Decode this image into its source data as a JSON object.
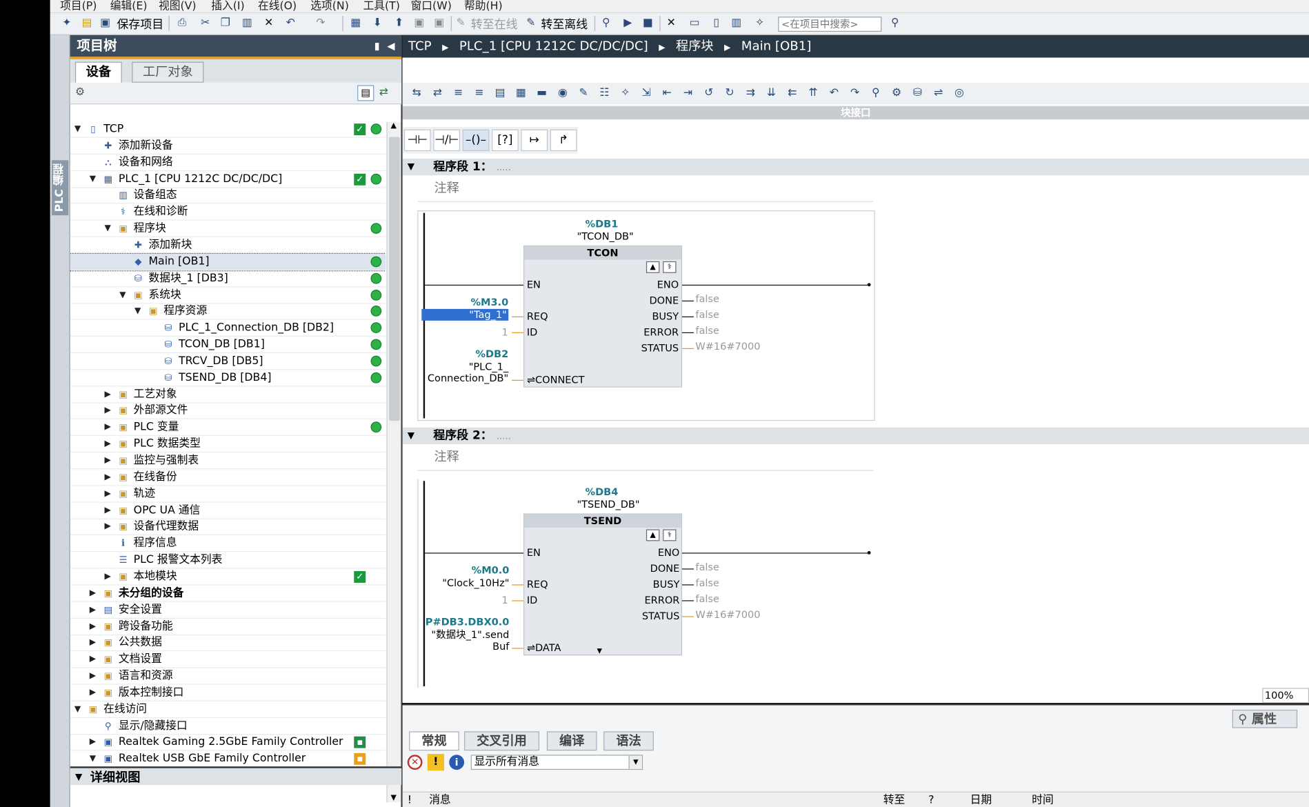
{
  "menu": [
    "项目(P)",
    "编辑(E)",
    "视图(V)",
    "插入(I)",
    "在线(O)",
    "选项(N)",
    "工具(T)",
    "窗口(W)",
    "帮助(H)"
  ],
  "toolbar": {
    "save_label": "保存项目",
    "go_online": "转至在线",
    "go_offline": "转至离线",
    "search_placeholder": "<在项目中搜索>"
  },
  "sidetab_label": "PLC 编程",
  "tree": {
    "title": "项目树",
    "tabs": [
      "设备",
      "工厂对象"
    ],
    "rows": [
      {
        "label": "TCP",
        "arrow": "▼",
        "level": 0,
        "check": true,
        "dot": true,
        "icon": "project-icon"
      },
      {
        "label": "添加新设备",
        "arrow": "",
        "level": 1,
        "icon": "add-device-icon"
      },
      {
        "label": "设备和网络",
        "arrow": "",
        "level": 1,
        "icon": "network-icon"
      },
      {
        "label": "PLC_1 [CPU 1212C DC/DC/DC]",
        "arrow": "▼",
        "level": 1,
        "check": true,
        "dot": true,
        "icon": "plc-icon"
      },
      {
        "label": "设备组态",
        "arrow": "",
        "level": 2,
        "icon": "device-config-icon"
      },
      {
        "label": "在线和诊断",
        "arrow": "",
        "level": 2,
        "icon": "diagnostics-icon"
      },
      {
        "label": "程序块",
        "arrow": "▼",
        "level": 2,
        "dot": true,
        "icon": "folder-icon"
      },
      {
        "label": "添加新块",
        "arrow": "",
        "level": 3,
        "icon": "add-block-icon"
      },
      {
        "label": "Main [OB1]",
        "arrow": "",
        "level": 3,
        "dot": true,
        "icon": "ob-icon",
        "selected": true
      },
      {
        "label": "数据块_1 [DB3]",
        "arrow": "",
        "level": 3,
        "dot": true,
        "icon": "db-icon"
      },
      {
        "label": "系统块",
        "arrow": "▼",
        "level": 3,
        "dot": true,
        "icon": "folder-icon"
      },
      {
        "label": "程序资源",
        "arrow": "▼",
        "level": 4,
        "dot": true,
        "icon": "folder-icon"
      },
      {
        "label": "PLC_1_Connection_DB [DB2]",
        "arrow": "",
        "level": 5,
        "dot": true,
        "icon": "db-icon"
      },
      {
        "label": "TCON_DB [DB1]",
        "arrow": "",
        "level": 5,
        "dot": true,
        "icon": "db-icon"
      },
      {
        "label": "TRCV_DB [DB5]",
        "arrow": "",
        "level": 5,
        "dot": true,
        "icon": "db-icon"
      },
      {
        "label": "TSEND_DB [DB4]",
        "arrow": "",
        "level": 5,
        "dot": true,
        "icon": "db-icon"
      },
      {
        "label": "工艺对象",
        "arrow": "▶",
        "level": 2,
        "icon": "folder-icon"
      },
      {
        "label": "外部源文件",
        "arrow": "▶",
        "level": 2,
        "icon": "folder-icon"
      },
      {
        "label": "PLC 变量",
        "arrow": "▶",
        "level": 2,
        "dot": true,
        "icon": "folder-icon"
      },
      {
        "label": "PLC 数据类型",
        "arrow": "▶",
        "level": 2,
        "icon": "folder-icon"
      },
      {
        "label": "监控与强制表",
        "arrow": "▶",
        "level": 2,
        "icon": "folder-icon"
      },
      {
        "label": "在线备份",
        "arrow": "▶",
        "level": 2,
        "icon": "folder-icon"
      },
      {
        "label": "轨迹",
        "arrow": "▶",
        "level": 2,
        "icon": "folder-icon"
      },
      {
        "label": "OPC UA 通信",
        "arrow": "▶",
        "level": 2,
        "icon": "folder-icon"
      },
      {
        "label": "设备代理数据",
        "arrow": "▶",
        "level": 2,
        "icon": "folder-icon"
      },
      {
        "label": "程序信息",
        "arrow": "",
        "level": 2,
        "icon": "info-icon"
      },
      {
        "label": "PLC 报警文本列表",
        "arrow": "",
        "level": 2,
        "icon": "list-icon"
      },
      {
        "label": "本地模块",
        "arrow": "▶",
        "level": 2,
        "check": true,
        "icon": "folder-icon"
      },
      {
        "label": "未分组的设备",
        "arrow": "▶",
        "level": 1,
        "bold": true,
        "icon": "folder-icon"
      },
      {
        "label": "安全设置",
        "arrow": "▶",
        "level": 1,
        "icon": "security-icon"
      },
      {
        "label": "跨设备功能",
        "arrow": "▶",
        "level": 1,
        "icon": "folder-icon"
      },
      {
        "label": "公共数据",
        "arrow": "▶",
        "level": 1,
        "icon": "folder-icon"
      },
      {
        "label": "文档设置",
        "arrow": "▶",
        "level": 1,
        "icon": "folder-icon"
      },
      {
        "label": "语言和资源",
        "arrow": "▶",
        "level": 1,
        "icon": "folder-icon"
      },
      {
        "label": "版本控制接口",
        "arrow": "▶",
        "level": 1,
        "icon": "folder-icon"
      },
      {
        "label": "在线访问",
        "arrow": "▼",
        "level": 0,
        "icon": "folder-icon"
      },
      {
        "label": "显示/隐藏接口",
        "arrow": "",
        "level": 1,
        "icon": "interface-icon"
      },
      {
        "label": "Realtek Gaming 2.5GbE Family Controller",
        "arrow": "▶",
        "level": 1,
        "icon": "nic-icon",
        "net": "green"
      },
      {
        "label": "Realtek USB GbE Family Controller",
        "arrow": "▼",
        "level": 1,
        "icon": "nic-icon",
        "net": "orange"
      }
    ],
    "detail_label": "详细视图"
  },
  "editor": {
    "breadcrumb": [
      "TCP",
      "PLC_1 [CPU 1212C DC/DC/DC]",
      "程序块",
      "Main [OB1]"
    ],
    "interface_label": "块接口",
    "zoom": "100%",
    "networks": [
      {
        "title": "程序段 1：",
        "dots": ".....",
        "comment": "注释",
        "db_addr": "%DB1",
        "db_name": "\"TCON_DB\"",
        "block": "TCON",
        "inputs": [
          {
            "pin": "EN"
          },
          {
            "pin": "REQ",
            "addr": "%M3.0",
            "tag": "\"Tag_1\""
          },
          {
            "pin": "ID",
            "value": "1"
          },
          {
            "pin": "⇌CONNECT",
            "addr": "%DB2",
            "tag": "\"PLC_1_",
            "tag2": "Connection_DB\""
          }
        ],
        "outputs": [
          {
            "pin": "ENO"
          },
          {
            "pin": "DONE",
            "value": "false"
          },
          {
            "pin": "BUSY",
            "value": "false"
          },
          {
            "pin": "ERROR",
            "value": "false"
          },
          {
            "pin": "STATUS",
            "value": "W#16#7000"
          }
        ]
      },
      {
        "title": "程序段 2：",
        "dots": ".....",
        "comment": "注释",
        "db_addr": "%DB4",
        "db_name": "\"TSEND_DB\"",
        "block": "TSEND",
        "inputs": [
          {
            "pin": "EN"
          },
          {
            "pin": "REQ",
            "addr": "%M0.0",
            "tag": "\"Clock_10Hz\""
          },
          {
            "pin": "ID",
            "value": "1"
          },
          {
            "pin": "⇌DATA",
            "addr": "P#DB3.DBX0.0",
            "tag": "\"数据块_1\".send",
            "tag2": "Buf"
          }
        ],
        "outputs": [
          {
            "pin": "ENO"
          },
          {
            "pin": "DONE",
            "value": "false"
          },
          {
            "pin": "BUSY",
            "value": "false"
          },
          {
            "pin": "ERROR",
            "value": "false"
          },
          {
            "pin": "STATUS",
            "value": "W#16#7000"
          }
        ]
      }
    ]
  },
  "bottom": {
    "properties_label": "属性",
    "tabs": [
      "常规",
      "交叉引用",
      "编译",
      "语法"
    ],
    "filter": "显示所有消息",
    "columns": [
      "!",
      "消息",
      "转至",
      "?",
      "日期",
      "时间"
    ]
  }
}
